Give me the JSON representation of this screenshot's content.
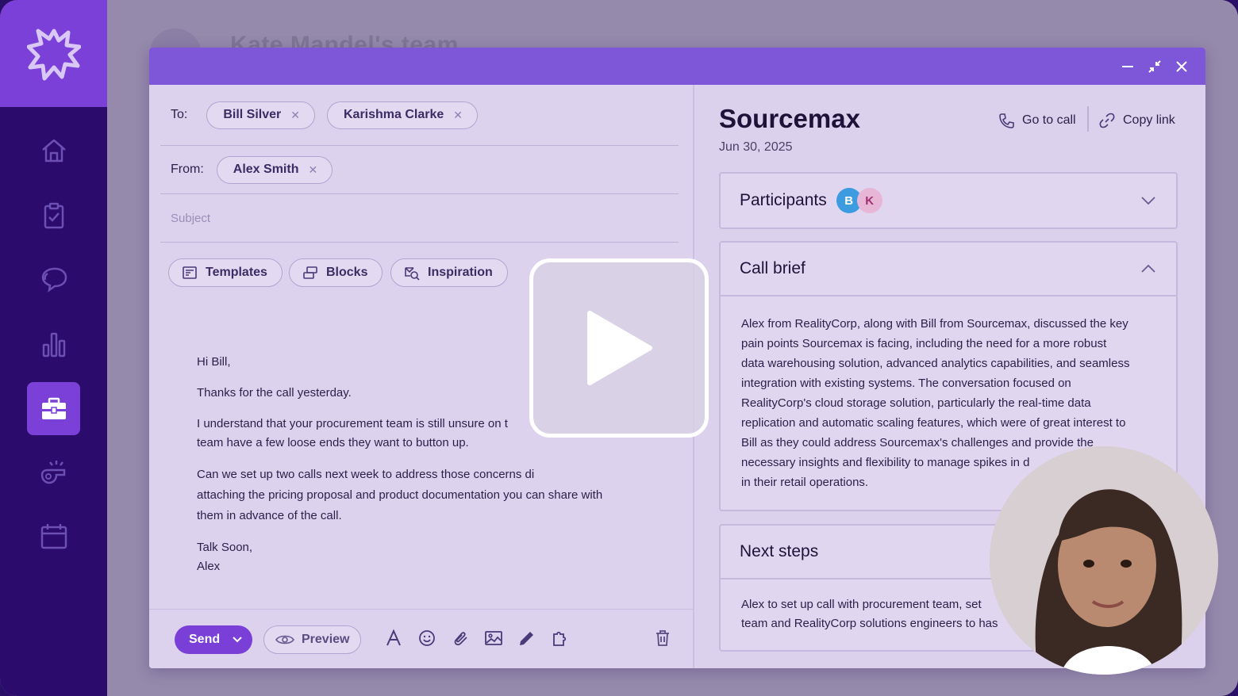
{
  "background_page": {
    "title": "Kate Mandel's team"
  },
  "sidebar": {
    "items": [
      {
        "icon": "home-icon"
      },
      {
        "icon": "clipboard-check-icon"
      },
      {
        "icon": "chat-bubbles-icon"
      },
      {
        "icon": "bar-chart-icon"
      },
      {
        "icon": "briefcase-icon",
        "active": true
      },
      {
        "icon": "whistle-icon"
      },
      {
        "icon": "calendar-icon"
      }
    ]
  },
  "compose": {
    "to_label": "To:",
    "to_recipients": [
      "Bill Silver",
      "Karishma Clarke"
    ],
    "from_label": "From:",
    "from_sender": "Alex Smith",
    "subject_placeholder": "Subject",
    "toolbar": {
      "templates": "Templates",
      "blocks": "Blocks",
      "inspiration": "Inspiration"
    },
    "body": {
      "greeting": "Hi Bill,",
      "p1": "Thanks for the call yesterday.",
      "p2_line1": "I understand that your procurement team is still unsure on t",
      "p2_line2": "team have a few loose ends they want to button up.",
      "p3_line1": "Can we set up two calls next week to address those concerns di",
      "p3_line2": "attaching the pricing proposal and product documentation you can share with",
      "p3_line3": "them in advance of the call.",
      "signoff": "Talk Soon,",
      "signature": "Alex"
    },
    "footer": {
      "send": "Send",
      "preview": "Preview"
    }
  },
  "call": {
    "title": "Sourcemax",
    "date": "Jun 30, 2025",
    "go_to_call": "Go to call",
    "copy_link": "Copy link",
    "participants_label": "Participants",
    "participants": [
      {
        "initial": "B",
        "color": "#3d9be0",
        "text_color": "#ffffff"
      },
      {
        "initial": "K",
        "color": "#e7b6d6",
        "text_color": "#a03070"
      }
    ],
    "call_brief_label": "Call brief",
    "call_brief_lines": [
      "Alex from RealityCorp, along with Bill from Sourcemax, discussed the key",
      "pain points Sourcemax is facing, including the need for a more robust",
      "data warehousing solution, advanced analytics capabilities, and seamless",
      "integration with existing systems. The conversation focused on",
      "RealityCorp's cloud storage solution, particularly the real-time data",
      "replication and automatic scaling features, which were of great interest to",
      "Bill as they could address Sourcemax's challenges and provide the",
      "necessary insights and flexibility to manage spikes in d",
      "in their retail operations."
    ],
    "next_steps_label": "Next steps",
    "next_steps_lines": [
      "Alex to set up call with procurement team, set",
      "team and RealityCorp solutions engineers to has"
    ]
  },
  "colors": {
    "brand_purple": "#7a3fd6",
    "header_purple": "#7e56d8",
    "sidebar_dark": "#2b0b6b"
  }
}
